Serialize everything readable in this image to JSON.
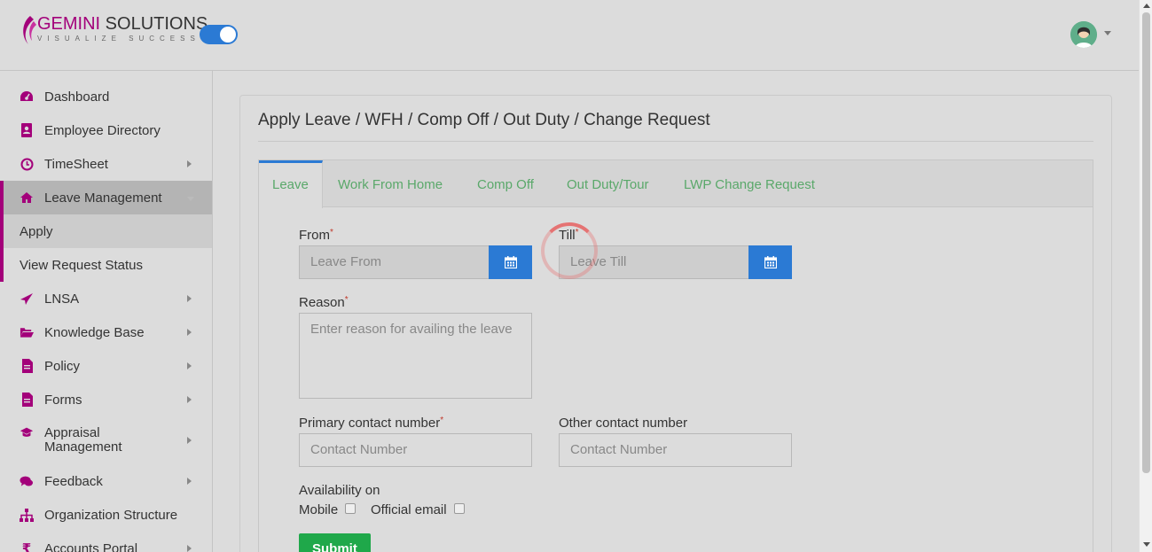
{
  "header": {
    "logo_brand": "GEMINI",
    "logo_rest": " SOLUTIONS",
    "logo_tagline": "VISUALIZE SUCCESS"
  },
  "sidebar": {
    "items": [
      {
        "label": "Dashboard",
        "icon": "dashboard-icon"
      },
      {
        "label": "Employee Directory",
        "icon": "address-book-icon"
      },
      {
        "label": "TimeSheet",
        "icon": "clock-icon"
      },
      {
        "label": "Leave Management",
        "icon": "home-icon"
      },
      {
        "label": "LNSA",
        "icon": "paper-plane-icon"
      },
      {
        "label": "Knowledge Base",
        "icon": "folder-open-icon"
      },
      {
        "label": "Policy",
        "icon": "file-icon"
      },
      {
        "label": "Forms",
        "icon": "file-icon"
      },
      {
        "label": "Appraisal Management",
        "icon": "graduation-cap-icon"
      },
      {
        "label": "Feedback",
        "icon": "comments-icon"
      },
      {
        "label": "Organization Structure",
        "icon": "sitemap-icon"
      },
      {
        "label": "Accounts Portal",
        "icon": "rupee-icon"
      }
    ],
    "sub_items": [
      {
        "label": "Apply"
      },
      {
        "label": "View Request Status"
      }
    ]
  },
  "main": {
    "title": "Apply Leave / WFH / Comp Off / Out Duty / Change Request",
    "tabs": [
      {
        "label": "Leave"
      },
      {
        "label": "Work From Home"
      },
      {
        "label": "Comp Off"
      },
      {
        "label": "Out Duty/Tour"
      },
      {
        "label": "LWP Change Request"
      }
    ],
    "form": {
      "from_label": "From",
      "from_placeholder": "Leave From",
      "till_label": "Till",
      "till_placeholder": "Leave Till",
      "reason_label": "Reason",
      "reason_placeholder": "Enter reason for availing the leave",
      "primary_contact_label": "Primary contact number",
      "primary_contact_placeholder": "Contact Number",
      "other_contact_label": "Other contact number",
      "other_contact_placeholder": "Contact Number",
      "availability_label": "Availability on",
      "mobile_label": "Mobile",
      "email_label": "Official email",
      "submit_label": "Submit",
      "required_mark": "*"
    }
  },
  "colors": {
    "brand": "#a3007a",
    "accent": "#2b7ad4",
    "tab_text": "#5aa86a",
    "submit": "#1fa84a"
  }
}
